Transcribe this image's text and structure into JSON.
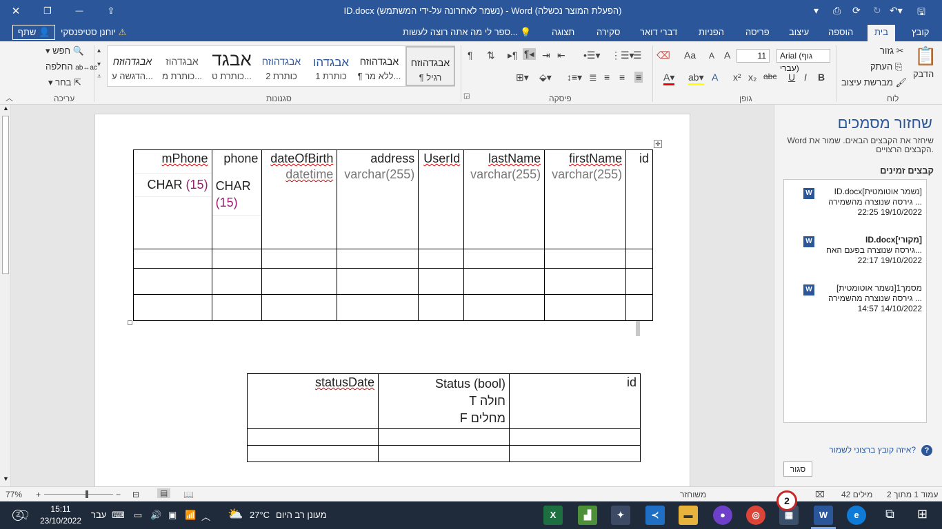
{
  "window": {
    "title": "ID.docx (נשמר לאחרונה על-ידי המשתמש) - Word (הפעלת המוצר נכשלה)",
    "close_icon": "✕",
    "restore_icon": "❐",
    "minimize_icon": "—"
  },
  "tabs": [
    "קובץ",
    "בית",
    "הוספה",
    "עיצוב",
    "פריסה",
    "הפניות",
    "דברי דואר",
    "סקירה",
    "תצוגה"
  ],
  "tellme": "ספר לי מה אתה רוצה לעשות...",
  "user": "יוחנן סטיפנסקי",
  "share": "שתף",
  "ribbon": {
    "clipboard": {
      "paste": "הדבק",
      "cut": "גזור",
      "copy": "העתק",
      "painter": "מברשת עיצוב",
      "label": "לוח"
    },
    "font": {
      "name": "Arial (גוף עברי)",
      "size": "11",
      "label": "גופן",
      "bold": "B",
      "italic": "I",
      "underline": "U",
      "strike": "abc",
      "sub": "x₂",
      "sup": "x²",
      "grow": "A",
      "shrink": "A",
      "case": "Aa"
    },
    "paragraph": {
      "label": "פיסקה"
    },
    "styles": {
      "label": "סגנונות",
      "items": [
        {
          "preview": "אבגדהוזח",
          "name": "¶ רגיל"
        },
        {
          "preview": "אבגדהוזח",
          "name": "¶ ללא מר..."
        },
        {
          "preview": "אבגדהו",
          "name": "כותרת 1"
        },
        {
          "preview": "אבגדהוזח",
          "name": "כותרת 2"
        },
        {
          "preview": "אבגד",
          "name": "כותרת ט..."
        },
        {
          "preview": "אבגדהוז",
          "name": "כותרת מ..."
        },
        {
          "preview": "אבגדהוזח",
          "name": "הדגשה ע..."
        }
      ]
    },
    "editing": {
      "find": "חפש",
      "replace": "החלפה",
      "select": "בחר",
      "label": "עריכה"
    }
  },
  "doc": {
    "table1": {
      "headers": [
        "id",
        "firstName",
        "lastName",
        "UserId",
        "address",
        "dateOfBirth",
        "phone",
        "mPhone"
      ],
      "types": [
        "",
        "varchar(255)",
        "varchar(255)",
        "",
        "varchar(255)",
        "datetime",
        "CHAR",
        "CHAR"
      ],
      "phone_len": "(15)",
      "mphone_len": "(15)"
    },
    "table2": {
      "headers": [
        "id",
        "Status (bool)",
        "statusDate"
      ],
      "status_t": "T חולה",
      "status_f": "F מחלים"
    }
  },
  "pane": {
    "title": "שחזור מסמכים",
    "desc": "Word שיחזר את הקבצים הבאים. שמור את הקבצים הרצויים.",
    "subtitle": "קבצים זמינים",
    "files": [
      {
        "name": "ID.docx[נשמר אוטומטית]",
        "desc": "גירסה שנוצרה מהשמירה ...",
        "date": "22:25 19/10/2022"
      },
      {
        "name": "ID.docx[מקורי]",
        "desc": "גירסה שנוצרה בפעם האח...",
        "date": "22:17 19/10/2022"
      },
      {
        "name": "מסמך1[נשמר אוטומטית]",
        "desc": "גירסה שנוצרה מהשמירה ...",
        "date": "14:57 14/10/2022"
      }
    ],
    "question": "איזה קובץ ברצוני לשמור?",
    "close": "סגור"
  },
  "status": {
    "page": "עמוד 1 מתוך 2",
    "words": "42 מילים",
    "recovered": "משוחזר",
    "zoom": "77%"
  },
  "taskbar": {
    "time": "15:11",
    "date": "23/10/2022",
    "lang": "עבר",
    "weather_temp": "27°C",
    "weather_text": "מעונן רב היום",
    "notif": "2",
    "badge": "2"
  }
}
